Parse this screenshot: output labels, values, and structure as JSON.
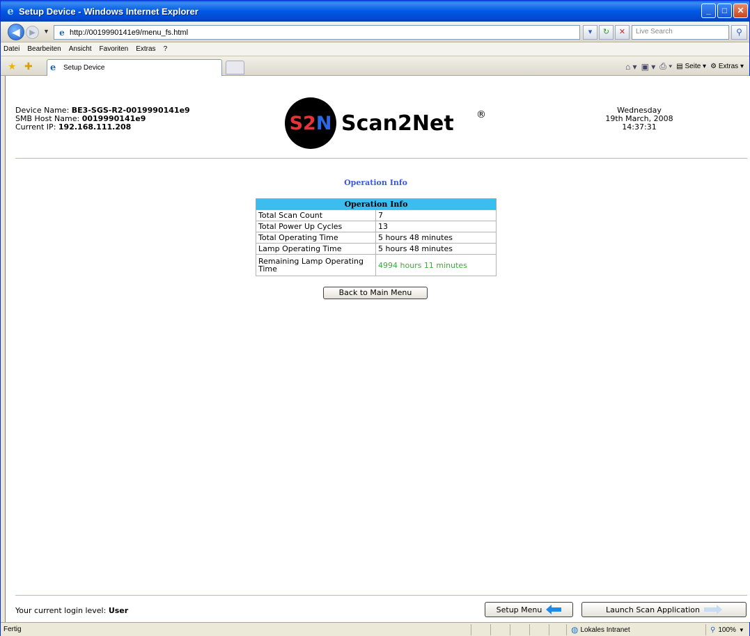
{
  "window": {
    "title": "Setup Device - Windows Internet Explorer"
  },
  "address": {
    "url": "http://0019990141e9/menu_fs.html",
    "search_placeholder": "Live Search"
  },
  "menu": [
    "Datei",
    "Bearbeiten",
    "Ansicht",
    "Favoriten",
    "Extras",
    "?"
  ],
  "tab": {
    "label": "Setup Device"
  },
  "commands": {
    "page": "Seite",
    "tools": "Extras"
  },
  "device": {
    "name_label": "Device Name:",
    "name": "BE3-SGS-R2-0019990141e9",
    "smb_label": "SMB Host Name:",
    "smb": "0019990141e9",
    "ip_label": "Current IP:",
    "ip": "192.168.111.208"
  },
  "logo": {
    "mark": "S2N",
    "text": "Scan2Net",
    "reg": "®"
  },
  "date": {
    "weekday": "Wednesday",
    "date": "19th March, 2008",
    "time": "14:37:31"
  },
  "page": {
    "heading": "Operation Info",
    "table_header": "Operation Info",
    "rows": [
      {
        "label": "Total Scan Count",
        "value": "7"
      },
      {
        "label": "Total Power Up Cycles",
        "value": "13"
      },
      {
        "label": "Total Operating Time",
        "value": "5 hours 48 minutes"
      },
      {
        "label": "Lamp Operating Time",
        "value": "5 hours 48 minutes"
      },
      {
        "label": "Remaining Lamp Operating Time",
        "value": "4994 hours 11 minutes"
      }
    ],
    "back_button": "Back to Main Menu"
  },
  "footer": {
    "login_label": "Your current login level:",
    "login_level": "User",
    "setup_button": "Setup Menu",
    "launch_button": "Launch Scan Application"
  },
  "status": {
    "text": "Fertig",
    "zone": "Lokales Intranet",
    "zoom": "100%"
  },
  "colors": {
    "table_header": "#3bbdf0",
    "heading": "#3a5ad8",
    "remaining": "#3aaa3a"
  }
}
